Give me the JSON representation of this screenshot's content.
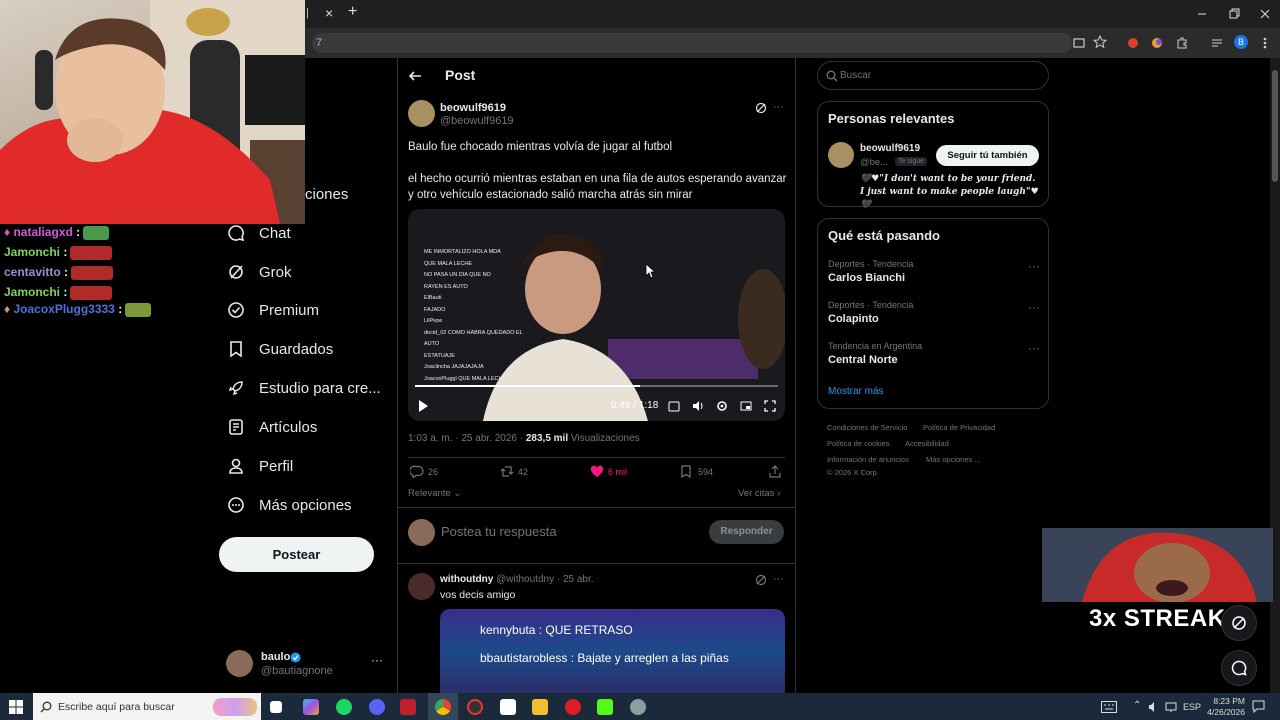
{
  "browser": {
    "tab_fragment": "|",
    "url_fragment": "7",
    "tab_close_glyph": "×",
    "new_tab_glyph": "+"
  },
  "chat": [
    {
      "user": "nataliagxd",
      "color": "#d05ad6"
    },
    {
      "user": "Jamonchi",
      "color": "#7fd45a"
    },
    {
      "user": "centavitto",
      "color": "#9c8bd8"
    },
    {
      "user": "Jamonchi",
      "color": "#7fd45a"
    },
    {
      "user": "JoacoxPlugg3333",
      "color": "#4a74d8"
    }
  ],
  "nav": {
    "partial_item": "ciones",
    "items": [
      {
        "label": "Chat",
        "icon": "chat-icon"
      },
      {
        "label": "Grok",
        "icon": "grok-icon"
      },
      {
        "label": "Premium",
        "icon": "premium-icon"
      },
      {
        "label": "Guardados",
        "icon": "bookmark-icon"
      },
      {
        "label": "Estudio para cre...",
        "icon": "rocket-icon"
      },
      {
        "label": "Artículos",
        "icon": "article-icon"
      },
      {
        "label": "Perfil",
        "icon": "profile-icon"
      },
      {
        "label": "Más opciones",
        "icon": "more-options-icon"
      }
    ],
    "post_button": "Postear",
    "account": {
      "name": "baulo",
      "handle": "@bautiagnone",
      "more": "···"
    }
  },
  "post": {
    "header_title": "Post",
    "author_name": "beowulf9619",
    "author_handle": "@beowulf9619",
    "more_glyph": "···",
    "text_1": "Baulo fue chocado mientras volvía de jugar al futbol",
    "text_2": "el hecho ocurrió mientras estaban en una fila de autos esperando avanzar y otro vehículo estacionado salió marcha atrás sin mirar",
    "video": {
      "time_current": "0:49",
      "time_sep": "/",
      "time_total": "1:18",
      "progress": 0.62,
      "overlay_chat": [
        "ME INMORTALIZO HOLA MDA",
        "QUE MALA LECHE",
        "NO PASA UN DIA QUE NO",
        "RAYEN ES AUTO",
        "FAJADO",
        "COMO HABRA QUEDADO EL",
        "AUTO",
        "ESTATUAJE",
        "JAJAJAJAJA",
        "QUE MALA LECHE"
      ],
      "overlay_users": [
        "LilPepe",
        "decid_02",
        "ElBauti",
        "Joaclincha",
        "JoacoxPluggl"
      ]
    },
    "meta_time": "1:03 a. m. · 25 abr. 2026 ·",
    "meta_views": "283,5 mil",
    "meta_views_label": "Visualizaciones",
    "stats": {
      "replies": "26",
      "reposts": "42",
      "likes": "6 mil",
      "bookmarks": "594"
    },
    "sort_label": "Relevante",
    "quotes_label": "Ver citas",
    "reply_placeholder": "Postea tu respuesta",
    "reply_button": "Responder"
  },
  "reply": {
    "author_name": "withoutdny",
    "author_handle": "@withoutdny",
    "date": "· 25 abr.",
    "text": "vos decis amigo",
    "image_lines": [
      {
        "user": "kennybuta",
        "msg": ": QUE RETRASO"
      },
      {
        "user": "bbautistarobless",
        "msg": ": Bajate y arreglen a las piñas"
      }
    ]
  },
  "sidebar": {
    "search_placeholder": "Buscar",
    "relevant_title": "Personas relevantes",
    "relevant_person": {
      "name": "beowulf9619",
      "handle": "@be...",
      "badge": "Te sigue",
      "button": "Seguir tú también",
      "bio": "🖤♥\"I don't want to be your friend. I just want to make people laugh\"♥🖤"
    },
    "trends_title": "Qué está pasando",
    "trends": [
      {
        "category": "Deportes · Tendencia",
        "name": "Carlos Bianchi"
      },
      {
        "category": "Deportes · Tendencia",
        "name": "Colapinto"
      },
      {
        "category": "Tendencia en Argentina",
        "name": "Central Norte"
      }
    ],
    "show_more": "Mostrar más",
    "footer": {
      "terms": "Condiciones de Servicio",
      "privacy": "Política de Privacidad",
      "cookies": "Política de cookies",
      "accessibility": "Accesibilidad",
      "ads": "Información de anuncios",
      "more": "Más opciones ...",
      "copyright": "© 2026 X Corp."
    }
  },
  "overlay": {
    "streak": "3x STREAK"
  },
  "taskbar": {
    "search_placeholder": "Escribe aquí para buscar",
    "lang": "ESP",
    "time": "8:23 PM",
    "date": "4/26/2026"
  },
  "colors": {
    "accent": "#1d9bf0",
    "like": "#f91880",
    "taskbar": "#1b2a3a"
  }
}
